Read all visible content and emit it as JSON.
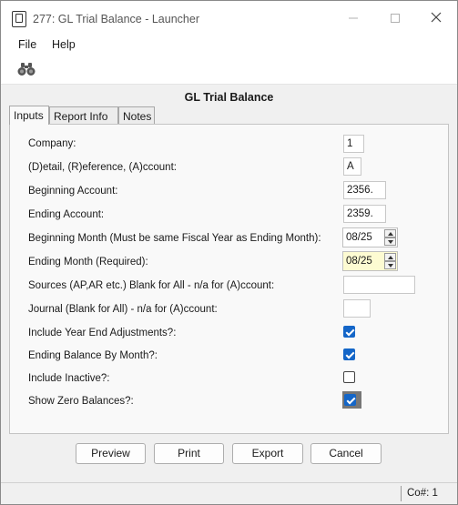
{
  "window": {
    "title": "277: GL Trial Balance - Launcher"
  },
  "menu": {
    "file": "File",
    "help": "Help"
  },
  "toolbar": {
    "icon": "binoculars-icon"
  },
  "form": {
    "title": "GL Trial Balance"
  },
  "tabs": [
    {
      "label": "Inputs",
      "active": true
    },
    {
      "label": "Report Info",
      "active": false
    },
    {
      "label": "Notes",
      "active": false
    }
  ],
  "inputs": {
    "company": {
      "label": "Company:",
      "value": "1"
    },
    "detail": {
      "label": "(D)etail, (R)eference, (A)ccount:",
      "value": "A"
    },
    "beginning_account": {
      "label": "Beginning Account:",
      "value": "2356."
    },
    "ending_account": {
      "label": "Ending Account:",
      "value": "2359."
    },
    "beginning_month": {
      "label": "Beginning Month (Must be same Fiscal Year as Ending Month):",
      "value": "08/25"
    },
    "ending_month": {
      "label": "Ending Month (Required):",
      "value": "08/25"
    },
    "sources": {
      "label": "Sources (AP,AR etc.) Blank for All - n/a for (A)ccount:",
      "value": ""
    },
    "journal": {
      "label": "Journal (Blank for All) - n/a for (A)ccount:",
      "value": ""
    },
    "year_end": {
      "label": "Include Year End Adjustments?:",
      "checked": true
    },
    "ending_balance": {
      "label": "Ending Balance By Month?:",
      "checked": true
    },
    "inactive": {
      "label": "Include Inactive?:",
      "checked": false
    },
    "zero_balances": {
      "label": "Show Zero Balances?:",
      "checked": true
    }
  },
  "buttons": {
    "preview": "Preview",
    "print": "Print",
    "export": "Export",
    "cancel": "Cancel"
  },
  "status": {
    "company": "Co#: 1"
  },
  "colors": {
    "accent": "#1466c8",
    "required_field": "#fdfbd2"
  }
}
